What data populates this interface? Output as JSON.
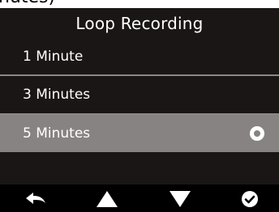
{
  "header": {
    "partial_text": "nutes)",
    "title": "Loop Recording"
  },
  "options": [
    {
      "label": "1 Minute",
      "selected": false
    },
    {
      "label": "3 Minutes",
      "selected": false
    },
    {
      "label": "5 Minutes",
      "selected": true
    }
  ],
  "toolbar": [
    "back-arrow-icon",
    "up-triangle-icon",
    "down-triangle-icon",
    "confirm-check-icon"
  ],
  "colors": {
    "panel": "#1b1616",
    "selected": "#888383",
    "divider": "#8d8888",
    "text": "#ffffff"
  }
}
